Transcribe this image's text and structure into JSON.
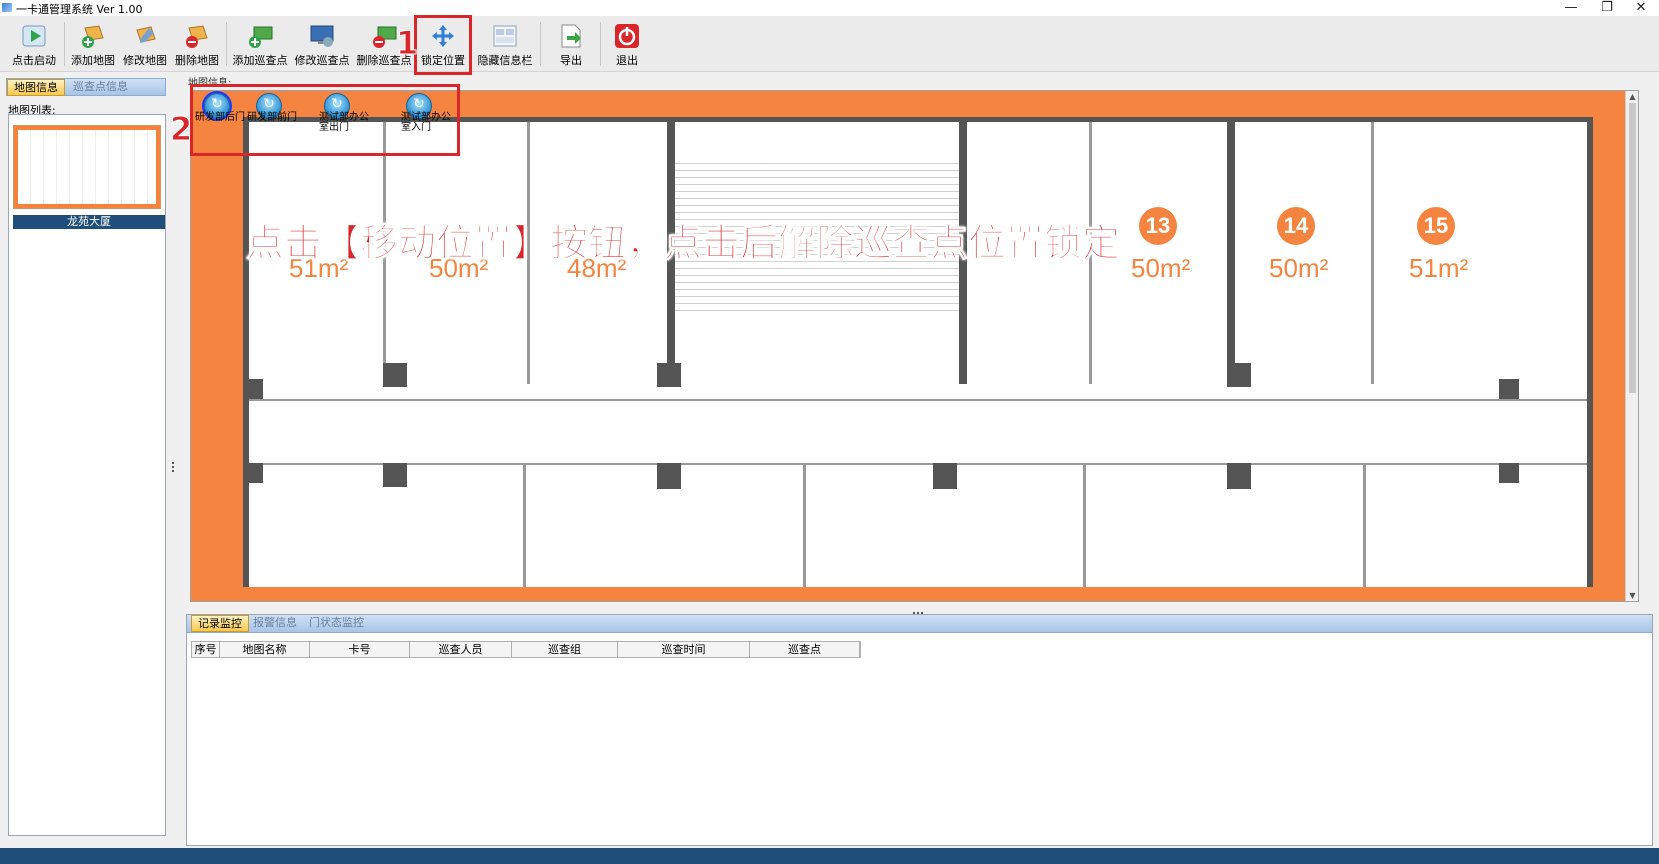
{
  "window": {
    "title": "一卡通管理系统  Ver 1.00",
    "controls": [
      "—",
      "❐",
      "✕"
    ]
  },
  "toolbar": {
    "items": [
      {
        "label": "点击启动",
        "icon": "play-icon"
      },
      {
        "label": "添加地图",
        "icon": "add-map-icon"
      },
      {
        "label": "修改地图",
        "icon": "edit-map-icon"
      },
      {
        "label": "删除地图",
        "icon": "delete-map-icon"
      },
      {
        "label": "添加巡查点",
        "icon": "add-checkpoint-icon"
      },
      {
        "label": "修改巡查点",
        "icon": "edit-checkpoint-icon"
      },
      {
        "label": "删除巡查点",
        "icon": "delete-checkpoint-icon"
      },
      {
        "label": "锁定位置",
        "icon": "move-icon"
      },
      {
        "label": "隐藏信息栏",
        "icon": "hide-panel-icon"
      },
      {
        "label": "导出",
        "icon": "export-icon"
      },
      {
        "label": "退出",
        "icon": "power-icon"
      }
    ]
  },
  "left_panel": {
    "tabs": [
      {
        "label": "地图信息",
        "active": true
      },
      {
        "label": "巡查点信息",
        "active": false
      }
    ],
    "map_list_label": "地图列表:",
    "maps": [
      {
        "name": "龙苑大厦"
      }
    ]
  },
  "map_panel": {
    "label": "地图信息:",
    "checkpoints": [
      {
        "label": "研发部后门",
        "selected": true
      },
      {
        "label": "研发部前门",
        "selected": false
      },
      {
        "label": "测试部办公室出门",
        "selected": false
      },
      {
        "label": "测试部办公室入门",
        "selected": false
      }
    ],
    "rooms": [
      {
        "area": "51m²"
      },
      {
        "area": "50m²"
      },
      {
        "area": "48m²"
      },
      {
        "number": "13",
        "area": "50m²"
      },
      {
        "number": "14",
        "area": "50m²"
      },
      {
        "number": "15",
        "area": "51m²"
      }
    ]
  },
  "annotations": {
    "instruction": "点击【移动位置】按钮，点击后解除巡查点位置锁定",
    "callout_1": "1",
    "callout_2": "2"
  },
  "bottom_panel": {
    "tabs": [
      {
        "label": "记录监控",
        "active": true
      },
      {
        "label": "报警信息",
        "active": false
      },
      {
        "label": "门状态监控",
        "active": false
      }
    ],
    "columns": [
      "序号",
      "地图名称",
      "卡号",
      "巡查人员",
      "巡查组",
      "巡查时间",
      "巡查点"
    ]
  },
  "colors": {
    "accent": "#d8262b",
    "map_background": "#f4843f",
    "statusbar": "#1e4e79"
  }
}
